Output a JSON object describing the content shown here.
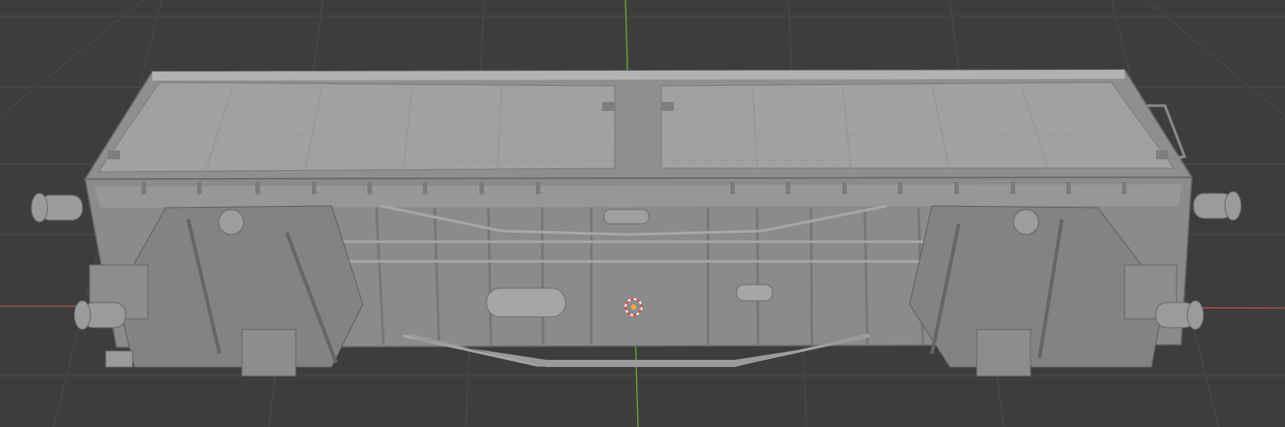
{
  "viewport": {
    "view": "3D Viewport",
    "shading": "solid",
    "background_color": "#3d3d3d",
    "grid_color": "#4a4a4a",
    "x_axis_color": "#c4555d",
    "y_axis_color": "#6fa83a"
  },
  "scene": {
    "object": "freight-wagon-model",
    "object_color": "#9a9a9a",
    "origin_marker": "3d-cursor-icon"
  }
}
